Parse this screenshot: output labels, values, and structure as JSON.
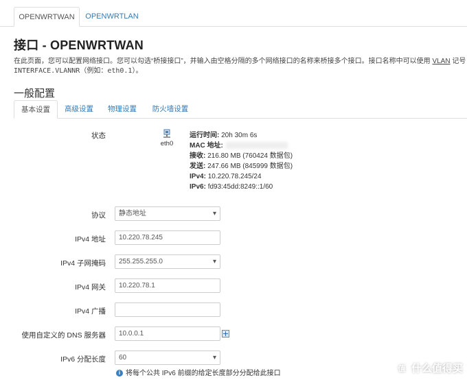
{
  "top_tabs": [
    {
      "label": "OPENWRTWAN",
      "active": true
    },
    {
      "label": "OPENWRTLAN",
      "active": false
    }
  ],
  "page": {
    "title": "接口 - OPENWRTWAN",
    "desc_line1_a": "在此页面，您可以配置网络接口。您可以勾选“桥接接口”，并输入由空格分隔的多个网络接口的名称来桥接多个接口。接口名称中可以使用",
    "desc_line1_vlan": "VLAN",
    "desc_line1_b": "记号",
    "desc_line2": "INTERFACE.VLANNR（例如：eth0.1）。"
  },
  "section_title": "一般配置",
  "sub_tabs": [
    {
      "label": "基本设置",
      "active": true
    },
    {
      "label": "高级设置",
      "active": false
    },
    {
      "label": "物理设置",
      "active": false
    },
    {
      "label": "防火墙设置",
      "active": false
    }
  ],
  "status": {
    "label": "状态",
    "iface_name": "eth0",
    "uptime_label": "运行时间:",
    "uptime_value": "20h 30m 6s",
    "mac_label": "MAC 地址:",
    "rx_label": "接收:",
    "rx_value": "216.80 MB (760424 数据包)",
    "tx_label": "发送:",
    "tx_value": "247.66 MB (845999 数据包)",
    "ipv4_label": "IPv4:",
    "ipv4_value": "10.220.78.245/24",
    "ipv6_label": "IPv6:",
    "ipv6_value": "fd93:45dd:8249::1/60"
  },
  "form": {
    "protocol_label": "协议",
    "protocol_value": "静态地址",
    "ipv4_addr_label": "IPv4 地址",
    "ipv4_addr_value": "10.220.78.245",
    "netmask_label": "IPv4 子网掩码",
    "netmask_value": "255.255.255.0",
    "gateway_label": "IPv4 网关",
    "gateway_value": "10.220.78.1",
    "broadcast_label": "IPv4 广播",
    "broadcast_value": "",
    "dns_label": "使用自定义的 DNS 服务器",
    "dns_value": "10.0.0.1",
    "ipv6_assign_label": "IPv6 分配长度",
    "ipv6_assign_value": "60",
    "ipv6_assign_hint": "将每个公共 IPv6 前缀的给定长度部分分配给此接口"
  },
  "watermark": {
    "badge": "值",
    "text": "什么值得买"
  }
}
